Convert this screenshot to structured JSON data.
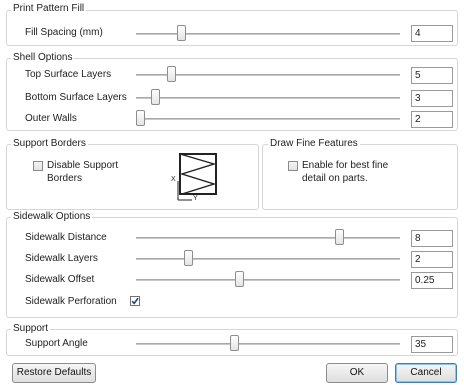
{
  "print_pattern_fill": {
    "title": "Print Pattern Fill",
    "fill_spacing": {
      "label": "Fill Spacing (mm)",
      "value": "4",
      "slider_fraction": 0.16
    }
  },
  "shell_options": {
    "title": "Shell Options",
    "top_surface_layers": {
      "label": "Top Surface Layers",
      "value": "5",
      "slider_fraction": 0.12
    },
    "bottom_surface_layers": {
      "label": "Bottom Surface Layers",
      "value": "3",
      "slider_fraction": 0.06
    },
    "outer_walls": {
      "label": "Outer Walls",
      "value": "2",
      "slider_fraction": 0.0
    }
  },
  "support_borders": {
    "title": "Support Borders",
    "disable_checkbox": {
      "label_line1": "Disable Support",
      "label_line2": "Borders",
      "checked": false
    },
    "axis_x": "X",
    "axis_y": "Y"
  },
  "draw_fine_features": {
    "title": "Draw Fine Features",
    "enable_checkbox": {
      "label_line1": "Enable for best fine",
      "label_line2": "detail on parts.",
      "checked": false
    }
  },
  "sidewalk_options": {
    "title": "Sidewalk Options",
    "sidewalk_distance": {
      "label": "Sidewalk Distance",
      "value": "8",
      "slider_fraction": 0.78
    },
    "sidewalk_layers": {
      "label": "Sidewalk  Layers",
      "value": "2",
      "slider_fraction": 0.19
    },
    "sidewalk_offset": {
      "label": "Sidewalk Offset",
      "value": "0.25",
      "slider_fraction": 0.39
    },
    "sidewalk_perforation": {
      "label": "Sidewalk Perforation",
      "checked": true
    }
  },
  "support": {
    "title": "Support",
    "support_angle": {
      "label": "Support Angle",
      "value": "35",
      "slider_fraction": 0.37
    }
  },
  "buttons": {
    "restore_defaults": "Restore Defaults",
    "ok": "OK",
    "cancel": "Cancel"
  },
  "colors": {
    "group_border": "#d6d6d6",
    "default_button_border": "#3c7fb1"
  }
}
